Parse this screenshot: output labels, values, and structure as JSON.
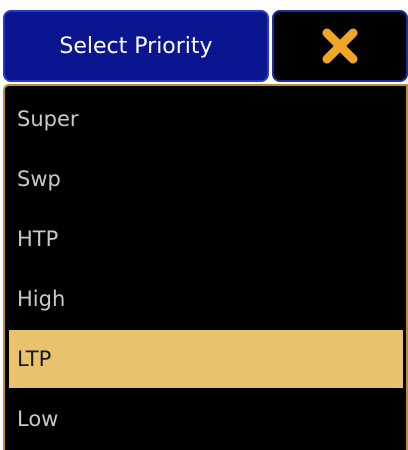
{
  "header": {
    "title": "Select Priority",
    "close_icon": "close-x-icon",
    "close_color": "#f0a726"
  },
  "priorities": {
    "items": [
      {
        "label": "Super",
        "selected": false
      },
      {
        "label": "Swp",
        "selected": false
      },
      {
        "label": "HTP",
        "selected": false
      },
      {
        "label": "High",
        "selected": false
      },
      {
        "label": "LTP",
        "selected": true
      },
      {
        "label": "Low",
        "selected": false
      }
    ]
  },
  "colors": {
    "title_bg": "#0b1590",
    "panel_border": "#bb8f2c",
    "selected_bg": "#e8c26c"
  }
}
